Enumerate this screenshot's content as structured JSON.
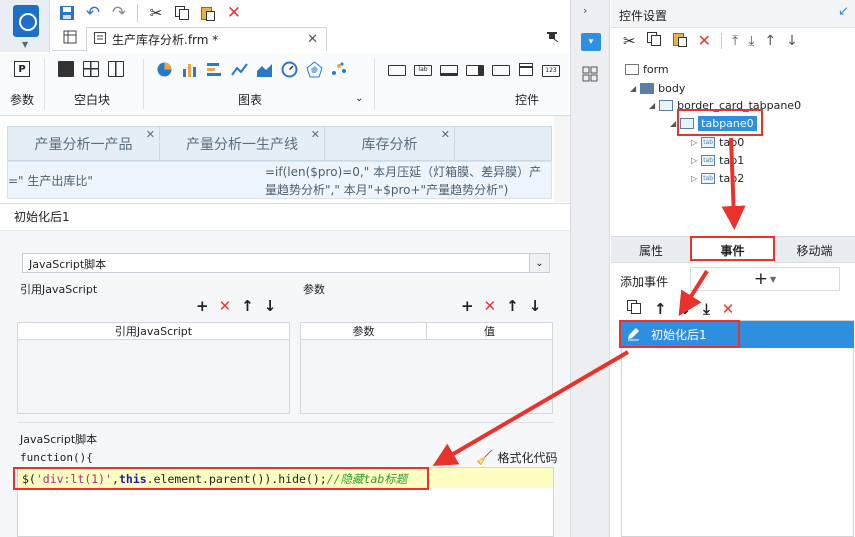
{
  "quick_toolbar": {
    "save": "save-icon",
    "undo": "undo-icon",
    "redo": "redo-icon",
    "cut": "cut-icon",
    "copy": "copy-icon",
    "paste": "paste-icon",
    "delete": "delete-icon"
  },
  "document_tab": {
    "title": "生产库存分析.frm *"
  },
  "ribbon": {
    "group_param": "参数",
    "group_blank": "空白块",
    "group_chart": "图表",
    "group_widget": "控件",
    "widget_sample_label": "lab",
    "widget_sample_num": "123"
  },
  "canvas": {
    "tabs": [
      "产量分析一产品",
      "产量分析一生产线",
      "库存分析"
    ],
    "cell_a": "=\" 生产出库比\"",
    "cell_b_line1": "=if(len($pro)=0,\" 本月压延（灯箱膜、差异膜）产",
    "cell_b_line2": "量趋势分析\",\" 本月\"+$pro+\"产量趋势分析\")"
  },
  "event_editor": {
    "title": "初始化后1",
    "type_select": "JavaScript脚本",
    "ref_js_label": "引用JavaScript",
    "param_label": "参数",
    "ref_js_col": "引用JavaScript",
    "param_col": "参数",
    "value_col": "值",
    "script_label": "JavaScript脚本",
    "func_decl": "function(){",
    "format_btn": "格式化代码",
    "code": {
      "prefix": "$(",
      "str": "'div:lt(1)'",
      "comma": ",",
      "kw": "this",
      "rest": ".element.parent()).hide();",
      "comment": "//隐藏tab标题"
    }
  },
  "right_panel": {
    "title": "控件设置",
    "tree": {
      "form": "form",
      "body": "body",
      "card": "border_card_tabpane0",
      "tabpane": "tabpane0",
      "tab0": "tab0",
      "tab1": "tab1",
      "tab2": "tab2",
      "node_icon_label": "tab"
    },
    "tabs": [
      "属性",
      "事件",
      "移动端"
    ],
    "add_event_label": "添加事件",
    "event_item": "初始化后1"
  },
  "colors": {
    "accent": "#2e8ee0",
    "highlight_box": "#e8322b",
    "code_bg": "#fffec2"
  }
}
